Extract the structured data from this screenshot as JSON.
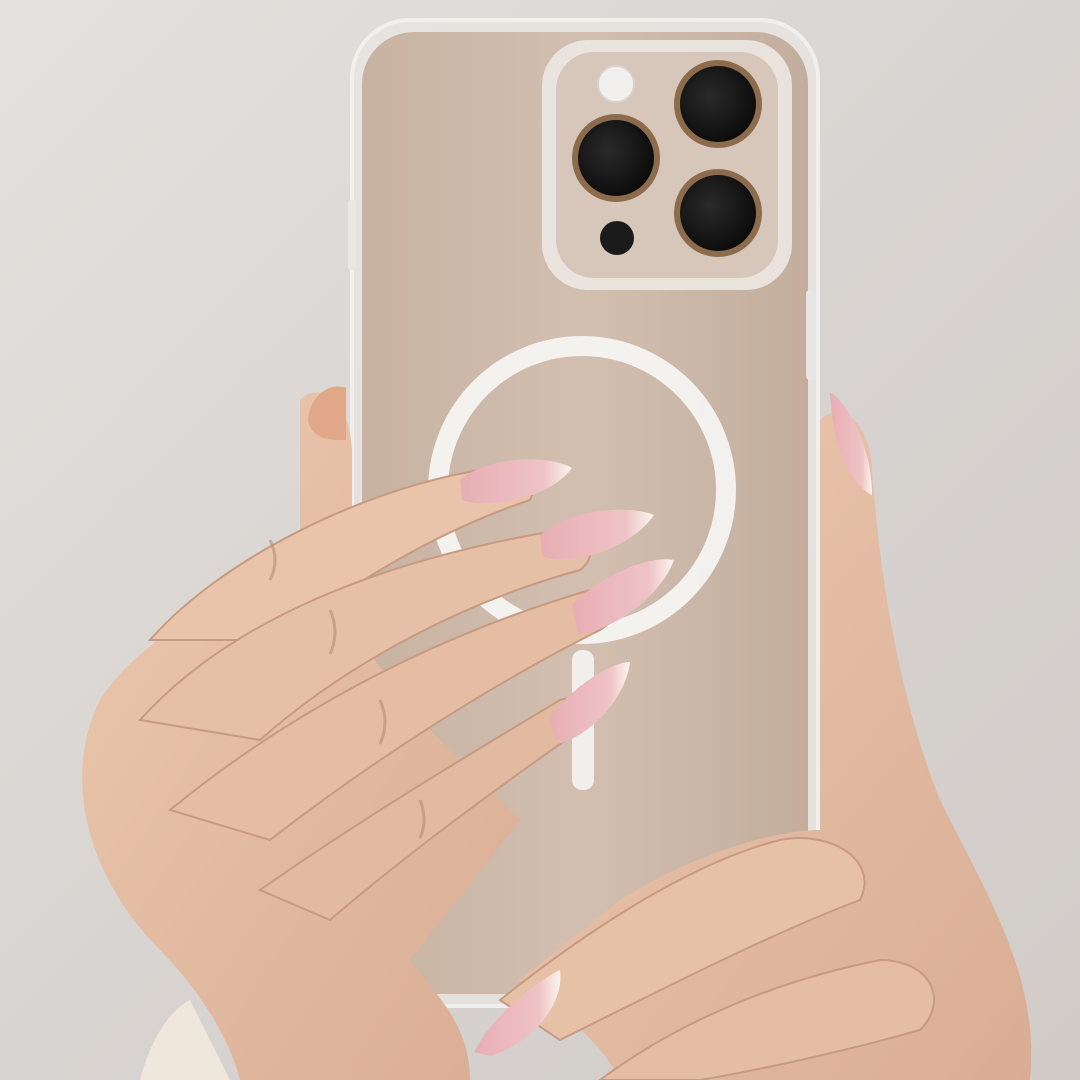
{
  "colors": {
    "wall": "#dcd9d6",
    "wall_shadow": "#cfcbc7",
    "phone_body": "#cdb9a9",
    "phone_edge": "#b8a595",
    "case_clear": "#e6e2df",
    "camera_plate": "#d6c6b8",
    "lens_ring": "#8a6a4a",
    "lens_glass": "#141414",
    "magsafe_ring": "#f3f3f1",
    "skin": "#e6c2a8",
    "skin_shadow": "#c99a80",
    "knuckle_line": "#b58a72",
    "nail_pink": "#e8b3b8",
    "nail_tip": "#fbf5f2",
    "sleeve": "#efe6dc"
  },
  "icons": [
    "camera-lens",
    "flash",
    "lidar-sensor",
    "magsafe-ring"
  ]
}
